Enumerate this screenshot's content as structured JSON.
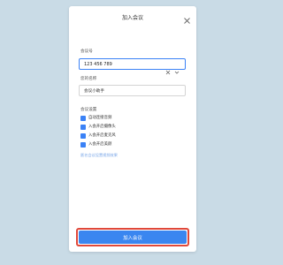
{
  "window": {
    "title": "加入会议"
  },
  "form": {
    "meeting_id_label": "会议号",
    "meeting_id_value": "123 456 789",
    "name_label": "您的名称",
    "name_value": "会议小助手",
    "settings_label": "会议设置",
    "options": [
      {
        "label": "自动连接音频",
        "checked": true
      },
      {
        "label": "入会开启摄像头",
        "checked": true
      },
      {
        "label": "入会开启麦克风",
        "checked": true
      },
      {
        "label": "入会开启美颜",
        "checked": true
      }
    ],
    "link_text": "匿名会议设置视频效果"
  },
  "actions": {
    "join_label": "加入会议"
  },
  "colors": {
    "background": "#c9dbe6",
    "accent": "#3a86f0",
    "highlight": "#e0483a"
  }
}
